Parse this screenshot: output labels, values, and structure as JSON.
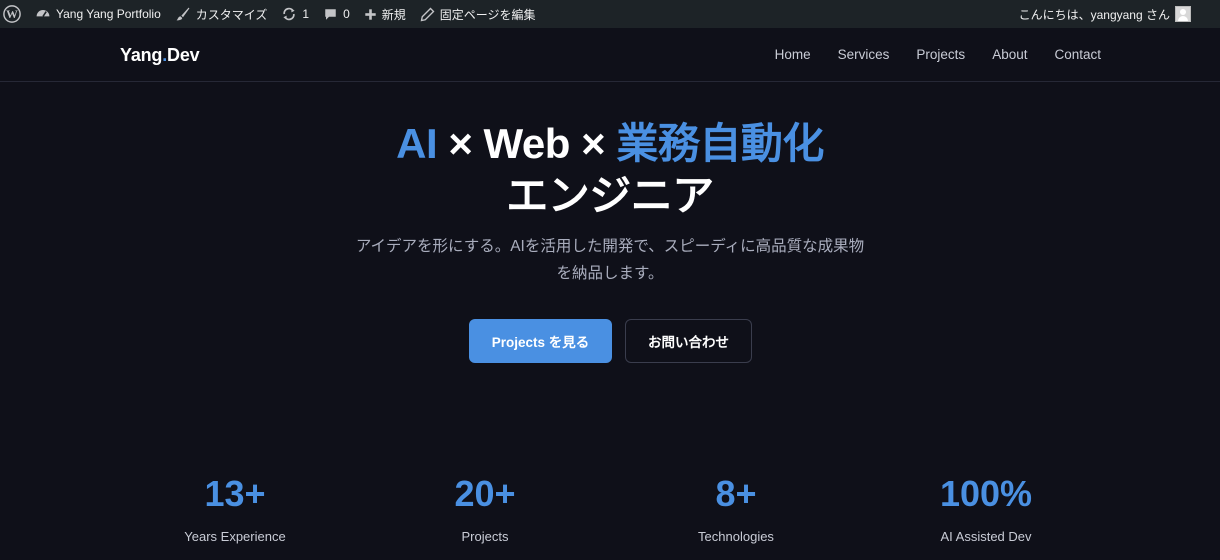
{
  "adminbar": {
    "site_name": "Yang Yang Portfolio",
    "customize": "カスタマイズ",
    "updates_count": "1",
    "comments_count": "0",
    "new": "新規",
    "edit_page": "固定ページを編集",
    "greeting": "こんにちは、yangyang さん",
    "icons": [
      "wordpress-icon",
      "dashboard-icon",
      "brush-icon",
      "refresh-icon",
      "comment-icon",
      "plus-icon",
      "pencil-icon",
      "avatar"
    ]
  },
  "header": {
    "logo_part1": "Yang",
    "logo_dot": ".",
    "logo_part2": "Dev",
    "nav": [
      "Home",
      "Services",
      "Projects",
      "About",
      "Contact"
    ]
  },
  "hero": {
    "title_ai": "AI",
    "title_mid": " × Web × ",
    "title_auto": "業務自動化",
    "title_line2": "エンジニア",
    "subtitle": "アイデアを形にする。AIを活用した開発で、スピーディに高品質な成果物を納品します。",
    "primary_button": "Projects を見る",
    "secondary_button": "お問い合わせ"
  },
  "stats": [
    {
      "value": "13+",
      "label": "Years Experience"
    },
    {
      "value": "20+",
      "label": "Projects"
    },
    {
      "value": "8+",
      "label": "Technologies"
    },
    {
      "value": "100%",
      "label": "AI Assisted Dev"
    }
  ],
  "colors": {
    "background": "#0f1019",
    "adminbar": "#1d2327",
    "accent": "#4a90e2",
    "muted_text": "#a9adbd"
  }
}
